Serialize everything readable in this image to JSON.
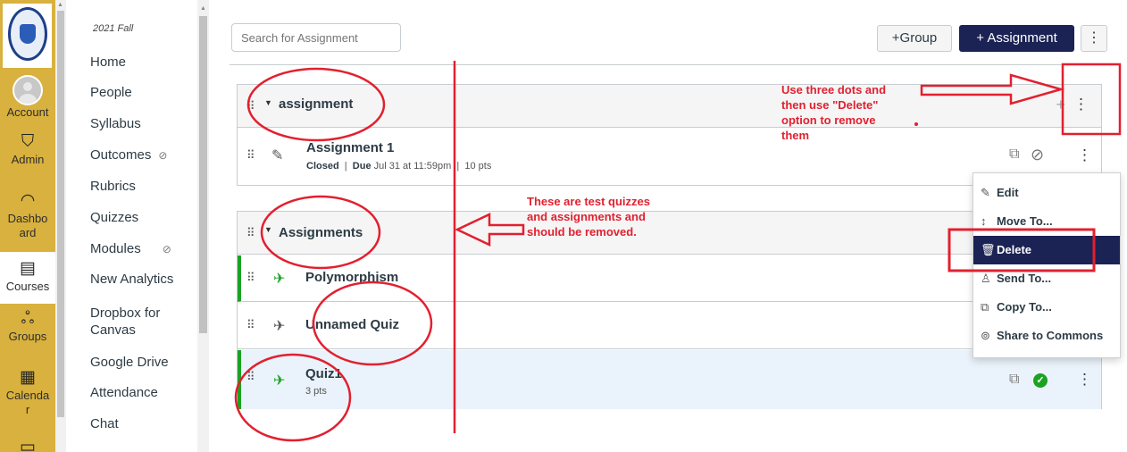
{
  "global_nav": {
    "items": [
      {
        "label": "Account",
        "icon": "user-avatar-icon"
      },
      {
        "label": "Admin",
        "icon": "shield-icon"
      },
      {
        "label": "Dashbo ard",
        "icon": "dashboard-gauge-icon"
      },
      {
        "label": "Courses",
        "icon": "book-icon"
      },
      {
        "label": "Groups",
        "icon": "people-icon"
      },
      {
        "label": "Calenda r",
        "icon": "calendar-icon"
      }
    ]
  },
  "course_nav": {
    "term": "2021 Fall",
    "links": [
      "Home",
      "People",
      "Syllabus",
      "Outcomes",
      "Rubrics",
      "Quizzes",
      "Modules",
      "New Analytics",
      "Dropbox for Canvas",
      "Google Drive",
      "Attendance",
      "Chat"
    ]
  },
  "toolbar": {
    "search_placeholder": "Search for Assignment",
    "group_button": "+Group",
    "assignment_button": "+ Assignment"
  },
  "groups": [
    {
      "title": "assignment",
      "rows": [
        {
          "title": "Assignment 1",
          "status": "Closed",
          "due_label": "Due",
          "due": "Jul 31 at 11:59pm",
          "points": "10 pts"
        }
      ]
    },
    {
      "title": "Assignments",
      "rows": [
        {
          "title": "Polymorphism"
        },
        {
          "title": "Unnamed Quiz"
        },
        {
          "title": "Quiz1",
          "points": "3 pts"
        }
      ]
    }
  ],
  "menu": {
    "items": [
      {
        "label": "Edit",
        "icon": "pencil-icon"
      },
      {
        "label": "Move To...",
        "icon": "move-arrows-icon"
      },
      {
        "label": "Delete",
        "icon": "trash-icon"
      },
      {
        "label": "Send To...",
        "icon": "send-user-icon"
      },
      {
        "label": "Copy To...",
        "icon": "copy-icon"
      },
      {
        "label": "Share to Commons",
        "icon": "commons-icon"
      }
    ]
  },
  "annotations": {
    "delete_instruction": [
      "Use three dots and",
      "then use \"Delete\"",
      "option to remove",
      "them"
    ],
    "test_note": [
      "These are test quizzes",
      "and assignments and",
      "should be removed."
    ],
    "color": "#e2202f"
  },
  "colors": {
    "nav_bg": "#d8b13e",
    "primary_button": "#1b2254",
    "published_green": "#1aa321"
  }
}
